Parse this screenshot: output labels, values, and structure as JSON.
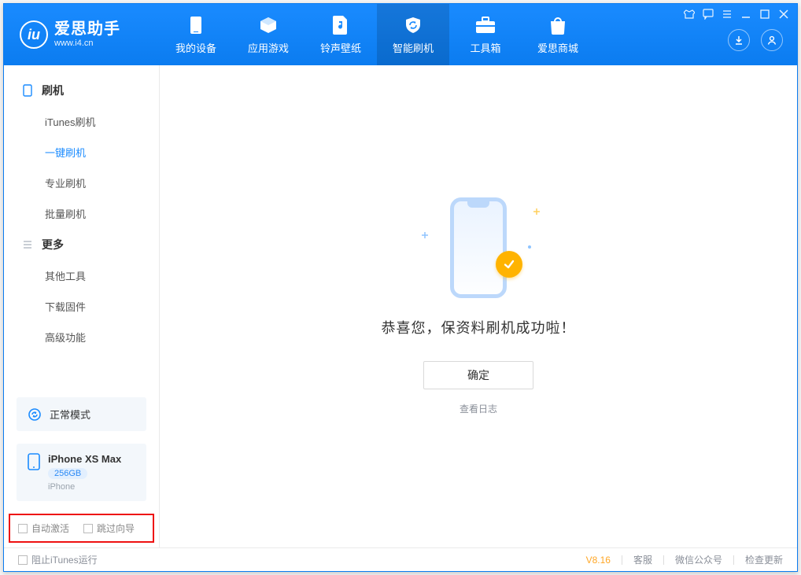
{
  "brand": {
    "name": "爱思助手",
    "sub": "www.i4.cn"
  },
  "nav": {
    "device": "我的设备",
    "apps": "应用游戏",
    "ring": "铃声壁纸",
    "flash": "智能刷机",
    "tools": "工具箱",
    "store": "爱思商城"
  },
  "sidebar": {
    "group_flash": "刷机",
    "itunes": "iTunes刷机",
    "oneclick": "一键刷机",
    "pro": "专业刷机",
    "batch": "批量刷机",
    "group_more": "更多",
    "other_tools": "其他工具",
    "download_fw": "下载固件",
    "advanced": "高级功能"
  },
  "mode": {
    "label": "正常模式"
  },
  "device_panel": {
    "name": "iPhone XS Max",
    "storage": "256GB",
    "type": "iPhone"
  },
  "checks": {
    "auto_activate": "自动激活",
    "skip_guide": "跳过向导"
  },
  "main": {
    "success": "恭喜您，保资料刷机成功啦！",
    "ok": "确定",
    "viewlog": "查看日志"
  },
  "footer": {
    "block_itunes": "阻止iTunes运行",
    "version": "V8.16",
    "service": "客服",
    "wechat": "微信公众号",
    "update": "检查更新"
  }
}
